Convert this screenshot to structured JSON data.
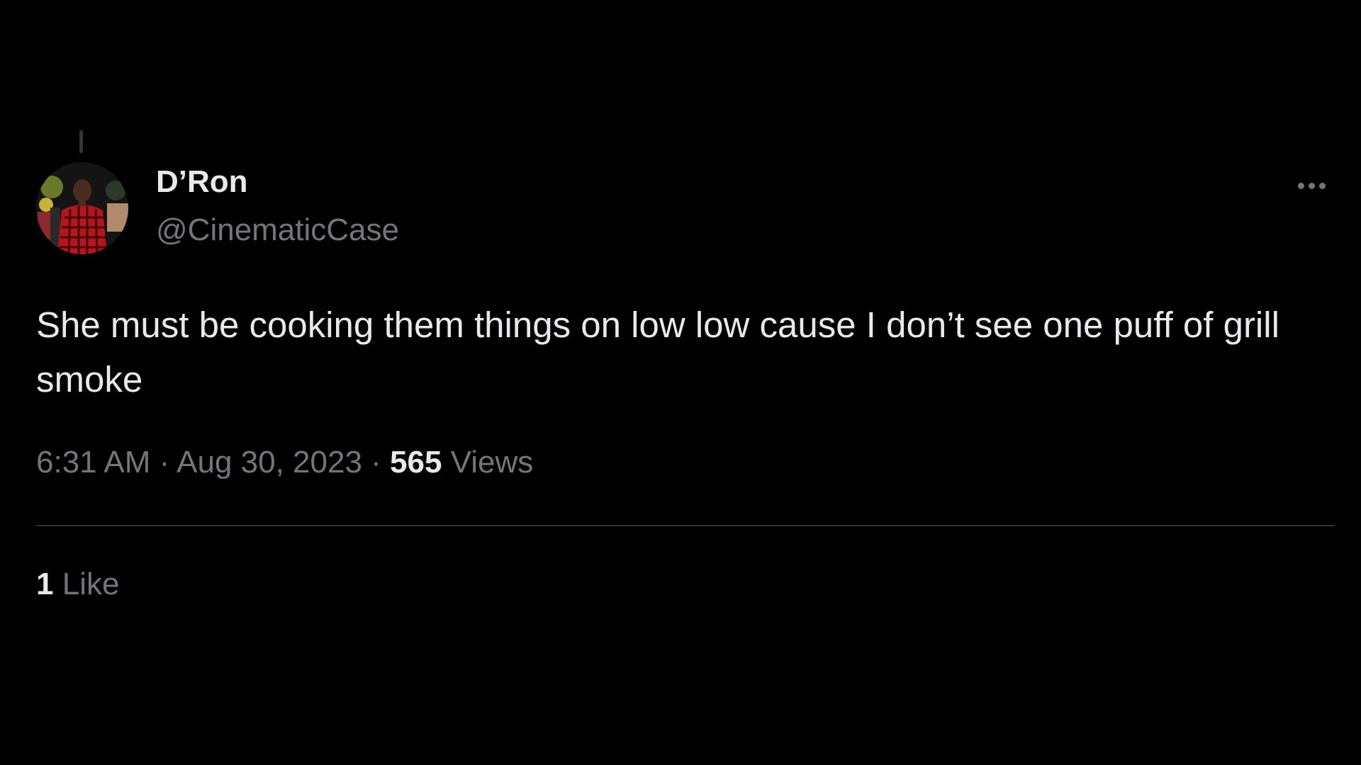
{
  "author": {
    "display_name": "D’Ron",
    "handle": "@CinematicCase"
  },
  "more_icon": "more-horizontal-icon",
  "tweet": {
    "text": "She must be cooking them things on low low cause I don’t see one puff of grill smoke"
  },
  "meta": {
    "time": "6:31 AM",
    "separator": "·",
    "date": "Aug 30, 2023",
    "views_count": "565",
    "views_label": "Views"
  },
  "engagement": {
    "like_count": "1",
    "like_label": "Like"
  },
  "colors": {
    "background": "#000000",
    "primary_text": "#e7e9ea",
    "secondary_text": "#71767b",
    "divider": "#2f3336"
  }
}
